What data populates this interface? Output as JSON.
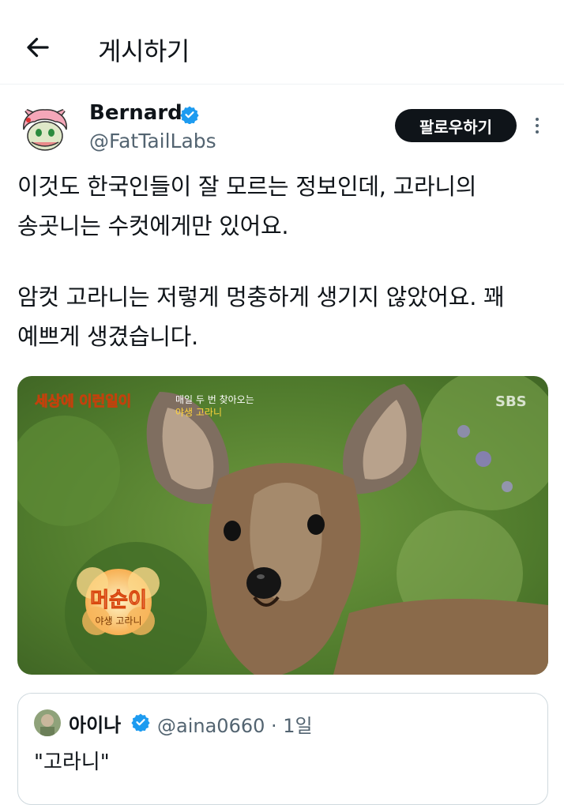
{
  "header": {
    "title": "게시하기",
    "back_icon": "arrow-left-icon"
  },
  "author": {
    "name": "Bernard",
    "handle": "@FatTailLabs",
    "verified": true
  },
  "follow_label": "팔로우하기",
  "body": {
    "lines": [
      "이것도 한국인들이 잘 모르는 정보인데, 고라니의",
      "송곳니는 수컷에게만 있어요.",
      "암컷 고라니는 저렇게 멍충하게 생기지 않았어요. 꽤",
      "예쁘게 생겼습니다."
    ]
  },
  "media": {
    "show_logo": "세상에 이런일이",
    "caption_top": "매일 두 번 찾아오는",
    "caption_top2": "야생 고라니",
    "watermark": "SBS",
    "name_tag": "머순이",
    "name_sub": "야생 고라니"
  },
  "quote": {
    "name": "아이나",
    "handle": "@aina0660",
    "time": "· 1일",
    "text": "\"고라니\""
  },
  "colors": {
    "accent": "#1d9bf0",
    "text": "#0f1419",
    "muted": "#536471"
  }
}
